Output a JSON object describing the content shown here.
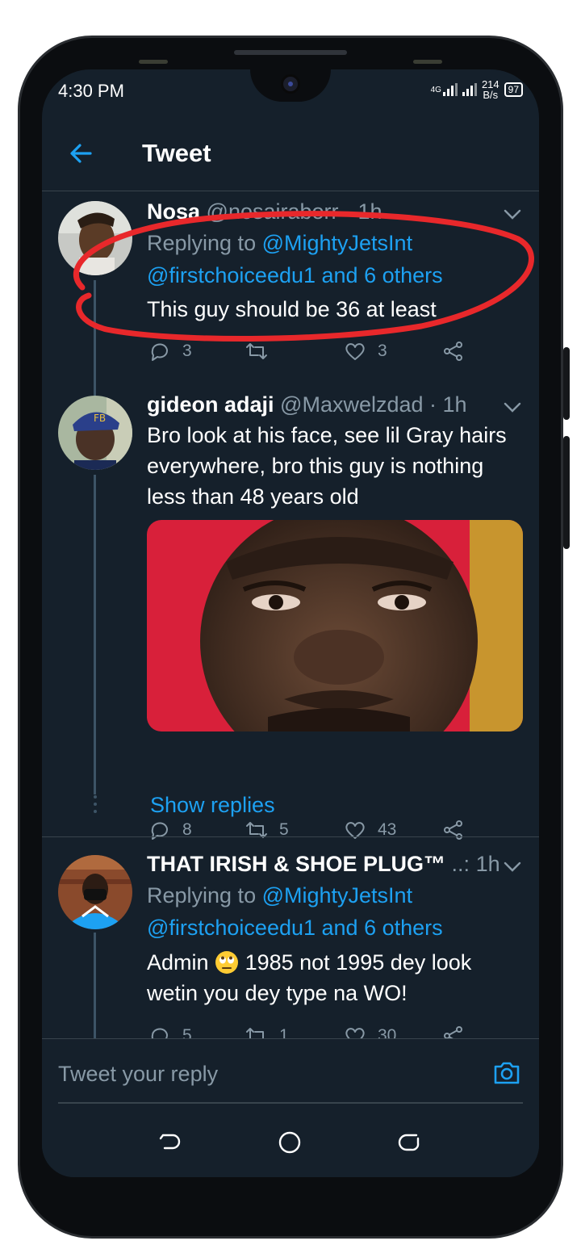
{
  "status_bar": {
    "time": "4:30 PM",
    "network": "4G",
    "speed_value": "214",
    "speed_unit": "B/s",
    "battery": "97"
  },
  "header": {
    "title": "Tweet",
    "back_icon": "arrow-left-icon"
  },
  "tweets": [
    {
      "display_name": "Nosa",
      "handle": "@nosairaborr",
      "time": "· 1h",
      "replying_prefix": "Replying to",
      "replying_user": "@MightyJetsInt",
      "replying_rest": "@firstchoiceedu1 and 6 others",
      "text": "This guy should be 36 at least",
      "replies": "3",
      "retweets": "",
      "likes": "3"
    },
    {
      "display_name": "gideon adaji",
      "handle": "@Maxwelzdad",
      "time": "· 1h",
      "text": "Bro look at his face, see lil Gray hairs everywhere, bro this guy is nothing less than 48 years old",
      "replies": "8",
      "retweets": "5",
      "likes": "43",
      "show_replies": "Show replies"
    },
    {
      "display_name": "THAT IRISH & SHOE PLUG™",
      "handle": "..:",
      "time": "1h",
      "replying_prefix": "Replying to",
      "replying_user": "@MightyJetsInt",
      "replying_rest": "@firstchoiceedu1 and 6 others",
      "text_before_emoji": "Admin",
      "text_after_emoji": "1985 not 1995 dey look wetin you dey type na WO!",
      "replies": "5",
      "retweets": "1",
      "likes": "30"
    }
  ],
  "composer": {
    "placeholder": "Tweet your reply",
    "camera_icon": "camera-icon"
  },
  "colors": {
    "background": "#15202b",
    "accent": "#1da1f2",
    "muted": "#8899a6",
    "annotation": "#e8282b"
  }
}
